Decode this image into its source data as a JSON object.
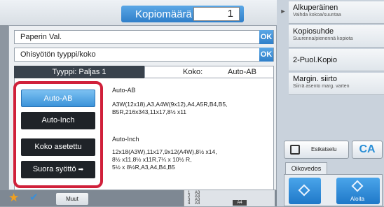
{
  "header": {
    "copies_label": "Kopiomäärä",
    "copies_value": "1"
  },
  "dialog": {
    "rows": [
      {
        "label": "Paperin Val.",
        "ok": "OK"
      },
      {
        "label": "Ohisyötön tyyppi/koko",
        "ok": "OK"
      }
    ],
    "tab_type": "Tyyppi:  Paljas 1",
    "tab_size_label": "Koko:",
    "tab_size_value": "Auto-AB",
    "options": [
      {
        "label": "Auto-AB",
        "active": true
      },
      {
        "label": "Auto-Inch",
        "active": false
      },
      {
        "label": "Koko asetettu",
        "active": false
      },
      {
        "label": "Suora syöttö",
        "active": false
      }
    ],
    "sections": [
      {
        "title": "Auto-AB",
        "lines": [
          "A3W(12x18),A3,A4W(9x12),A4,A5R,B4,B5,",
          "B5R,216x343,11x17,8½ x11"
        ]
      },
      {
        "title": "Auto-Inch",
        "lines": [
          "12x18(A3W),11x17,9x12(A4W),8½ x14,",
          "8½ x11,8½ x11R,7¼ x 10½ R,",
          "5½ x 8½R,A3,A4,B4,B5"
        ]
      }
    ]
  },
  "right_panel": {
    "items": [
      {
        "title": "Alkuperäinen",
        "subtitle": "Vaihda kokoa/suuntaa"
      },
      {
        "title": "Kopiosuhde",
        "subtitle": "Suurenna/pienennä kopiota"
      },
      {
        "title": "2-Puol.Kopio",
        "subtitle": ""
      },
      {
        "title": "Margin. siirto",
        "subtitle": "Siirrä asento marg. varten"
      }
    ],
    "preview_label": "Esikatselu",
    "ca_label": "CA",
    "tab_label": "Oikovedos",
    "start_label": "Aloita"
  },
  "bottom": {
    "muut_label": "Muut",
    "tray_rows": [
      "1",
      "2",
      "3",
      "4"
    ],
    "a4_tag": "A4",
    "tray_sizes": [
      "A3",
      "A3",
      "A3",
      "A3"
    ]
  },
  "colors": {
    "accent_blue": "#2f7fc9",
    "highlight_red": "#d0203a",
    "dark_button": "#1f2328",
    "ca_blue": "#2b8fd6",
    "star_orange": "#f0a020"
  },
  "icons": {
    "star": "star-icon",
    "check": "check-icon",
    "preview": "preview-icon",
    "arrow_right": "arrow-right-icon",
    "start_bw": "start-diamond-icon",
    "start_color": "start-diamond-icon"
  }
}
